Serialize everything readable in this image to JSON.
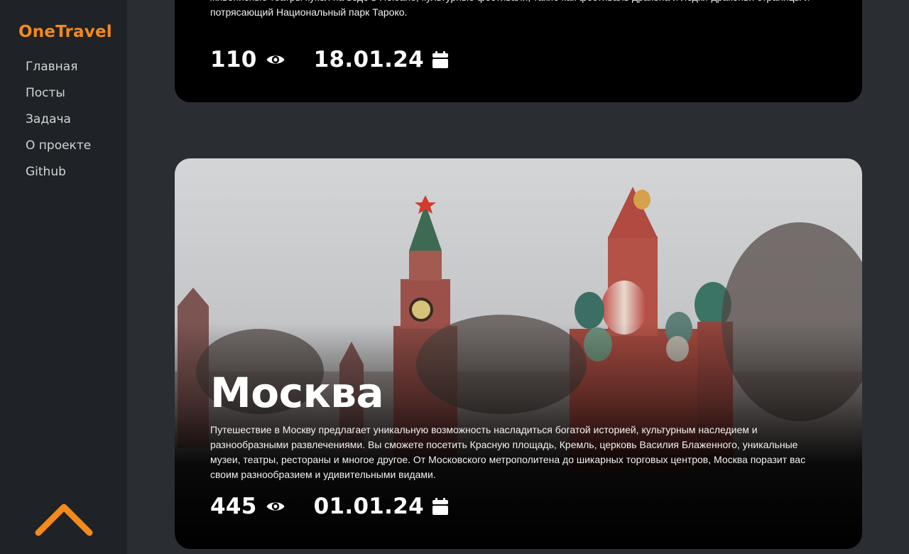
{
  "app": {
    "logo": "OneTravel"
  },
  "sidebar": {
    "items": [
      {
        "label": "Главная"
      },
      {
        "label": "Посты"
      },
      {
        "label": "Задача"
      },
      {
        "label": "О проекте"
      },
      {
        "label": "Github"
      }
    ]
  },
  "colors": {
    "accent": "#f28a1e",
    "sidebar_bg": "#1f2226",
    "page_bg": "#2a2d32"
  },
  "posts": [
    {
      "description": "обширной природы и впечатляющих горных пейзажей. Основные достопримечательности включают высотные небоскребы  в Тайбэе, живописные театры кукол на воде в Яоюане, культурные фестивали, такие как фестиваль дракона и лодки-драконьи страницы и потрясающий Национальный парк Тароко.",
      "views": "110",
      "date": "18.01.24"
    },
    {
      "title": "Москва",
      "description": "Путешествие в Москву предлагает уникальную возможность насладиться богатой историей, культурным наследием  и разнообразными развлечениями. Вы сможете посетить Красную площадь, Кремль, церковь Василия Блаженного, уникальные музеи, театры, рестораны и многое другое. От Московского метрополитена до шикарных торговых центров, Москва поразит вас своим разнообразием и удивительными видами.",
      "views": "445",
      "date": "01.01.24"
    }
  ],
  "icons": {
    "views": "eye-icon",
    "date": "calendar-icon",
    "scroll": "chevron-up-icon"
  }
}
